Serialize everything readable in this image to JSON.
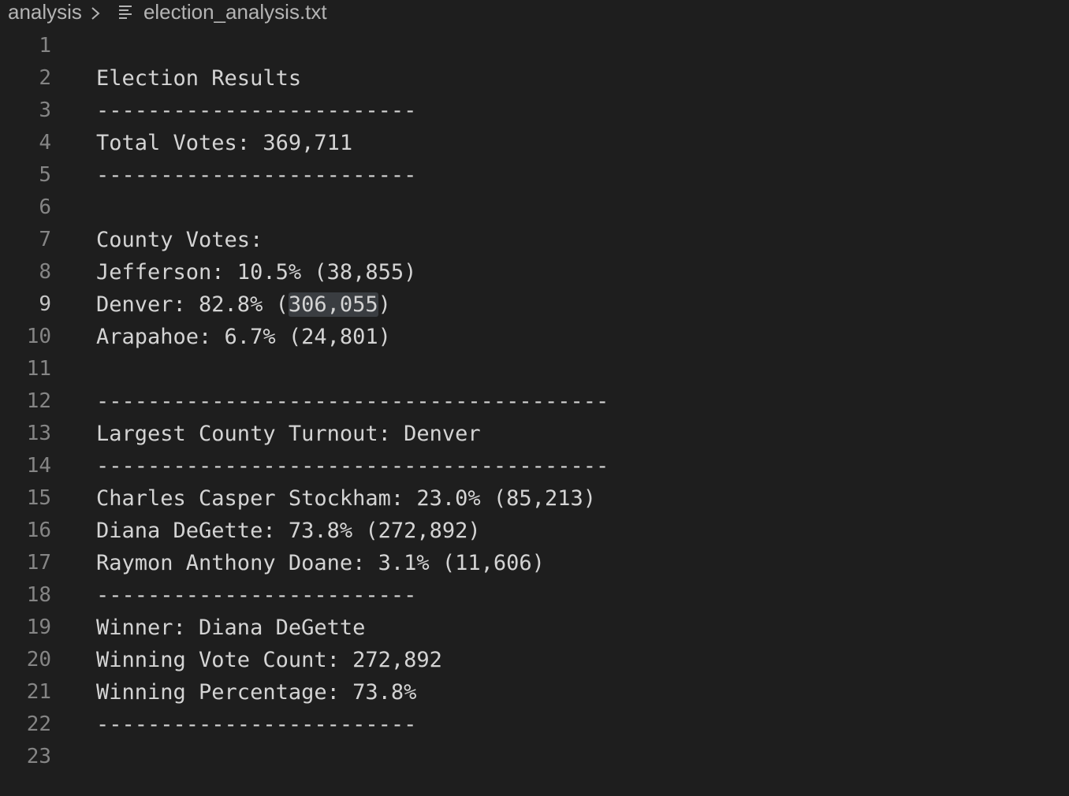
{
  "breadcrumb": {
    "folder": "analysis",
    "chevron_icon": "chevron-right-icon",
    "file_icon": "text-file-icon",
    "file": "election_analysis.txt"
  },
  "editor": {
    "active_line": 9,
    "lines": [
      {
        "n": "1",
        "text": ""
      },
      {
        "n": "2",
        "text": "Election Results"
      },
      {
        "n": "3",
        "text": "-------------------------"
      },
      {
        "n": "4",
        "text": "Total Votes: 369,711"
      },
      {
        "n": "5",
        "text": "-------------------------"
      },
      {
        "n": "6",
        "text": ""
      },
      {
        "n": "7",
        "text": "County Votes:"
      },
      {
        "n": "8",
        "text": "Jefferson: 10.5% (38,855)"
      },
      {
        "n": "9",
        "pre": "Denver: 82.8% (",
        "sel": "306,055",
        "post": ")"
      },
      {
        "n": "10",
        "text": "Arapahoe: 6.7% (24,801)"
      },
      {
        "n": "11",
        "text": ""
      },
      {
        "n": "12",
        "text": "----------------------------------------"
      },
      {
        "n": "13",
        "text": "Largest County Turnout: Denver"
      },
      {
        "n": "14",
        "text": "----------------------------------------"
      },
      {
        "n": "15",
        "text": "Charles Casper Stockham: 23.0% (85,213)"
      },
      {
        "n": "16",
        "text": "Diana DeGette: 73.8% (272,892)"
      },
      {
        "n": "17",
        "text": "Raymon Anthony Doane: 3.1% (11,606)"
      },
      {
        "n": "18",
        "text": "-------------------------"
      },
      {
        "n": "19",
        "text": "Winner: Diana DeGette"
      },
      {
        "n": "20",
        "text": "Winning Vote Count: 272,892"
      },
      {
        "n": "21",
        "text": "Winning Percentage: 73.8%"
      },
      {
        "n": "22",
        "text": "-------------------------"
      },
      {
        "n": "23",
        "text": ""
      }
    ]
  }
}
